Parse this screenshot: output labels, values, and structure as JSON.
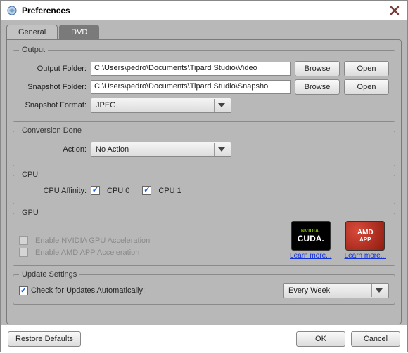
{
  "window": {
    "title": "Preferences"
  },
  "tabs": {
    "general": "General",
    "dvd": "DVD"
  },
  "output": {
    "legend": "Output",
    "output_folder_label": "Output Folder:",
    "output_folder_value": "C:\\Users\\pedro\\Documents\\Tipard Studio\\Video",
    "snapshot_folder_label": "Snapshot Folder:",
    "snapshot_folder_value": "C:\\Users\\pedro\\Documents\\Tipard Studio\\Snapsho",
    "snapshot_format_label": "Snapshot Format:",
    "snapshot_format_value": "JPEG",
    "browse": "Browse",
    "open": "Open"
  },
  "conversion": {
    "legend": "Conversion Done",
    "action_label": "Action:",
    "action_value": "No Action"
  },
  "cpu": {
    "legend": "CPU",
    "affinity_label": "CPU Affinity:",
    "cpu0": "CPU 0",
    "cpu1": "CPU 1"
  },
  "gpu": {
    "legend": "GPU",
    "nvidia_label": "Enable NVIDIA GPU Acceleration",
    "amd_label": "Enable AMD APP Acceleration",
    "learn_more": "Learn more...",
    "nvidia_badge_top": "NVIDIA.",
    "nvidia_badge_bot": "CUDA.",
    "amd_badge_top": "AMD",
    "amd_badge_bot": "APP"
  },
  "update": {
    "legend": "Update Settings",
    "check_label": "Check for Updates Automatically:",
    "interval": "Every Week"
  },
  "footer": {
    "restore": "Restore Defaults",
    "ok": "OK",
    "cancel": "Cancel"
  }
}
